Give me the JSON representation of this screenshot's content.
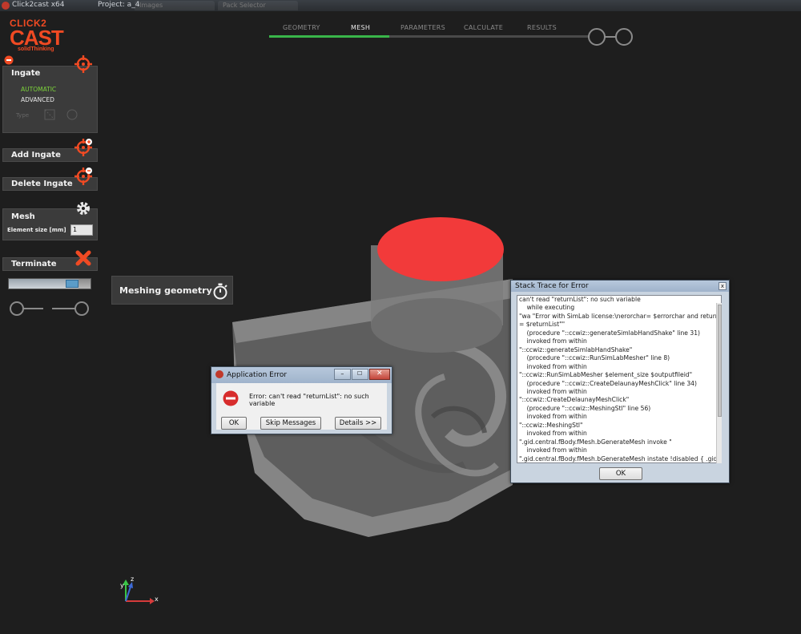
{
  "window": {
    "app_title": "Click2cast x64",
    "project": "Project: a_4",
    "ghost_tabs": [
      "Images",
      "Pack Selector"
    ]
  },
  "logo": {
    "line1": "CLICK2",
    "line2": "CAST",
    "line3": "solidThinking"
  },
  "steps": [
    {
      "label": "GEOMETRY",
      "state": "done"
    },
    {
      "label": "MESH",
      "state": "active"
    },
    {
      "label": "PARAMETERS",
      "state": "pending"
    },
    {
      "label": "CALCULATE",
      "state": "pending"
    },
    {
      "label": "RESULTS",
      "state": "pending"
    }
  ],
  "left_panel": {
    "ingate": {
      "title": "Ingate",
      "option_automatic": "AUTOMATIC",
      "option_advanced": "ADVANCED",
      "type_label": "Type"
    },
    "add_ingate": {
      "title": "Add Ingate"
    },
    "delete_ingate": {
      "title": "Delete Ingate"
    },
    "mesh": {
      "title": "Mesh",
      "element_size_label": "Element size [mm]",
      "element_size_value": "1"
    },
    "terminate": {
      "title": "Terminate"
    },
    "progress_fraction": 0.85
  },
  "tooltip": {
    "text": "Meshing geometry"
  },
  "app_error": {
    "title": "Application Error",
    "message": "Error: can't read \"returnList\": no such variable",
    "ok_label": "OK",
    "skip_label": "Skip Messages",
    "details_label": "Details >>"
  },
  "stack_trace": {
    "title": "Stack Trace for Error",
    "ok_label": "OK",
    "lines": [
      "can't read \"returnList\": no such variable",
      "    while executing",
      "\"wa \"Error with SimLab license:\\nerorchar= $errorchar and returnList",
      "= $returnList\"\"",
      "    (procedure \"::ccwiz::generateSimlabHandShake\" line 31)",
      "    invoked from within",
      "\"::ccwiz::generateSimlabHandShake\"",
      "    (procedure \"::ccwiz::RunSimLabMesher\" line 8)",
      "    invoked from within",
      "\"::ccwiz::RunSimLabMesher $element_size $outputfileid\"",
      "    (procedure \"::ccwiz::CreateDelaunayMeshClick\" line 34)",
      "    invoked from within",
      "\"::ccwiz::CreateDelaunayMeshClick\"",
      "    (procedure \"::ccwiz::MeshingStl\" line 56)",
      "    invoked from within",
      "\"::ccwiz::MeshingStl\"",
      "    invoked from within",
      "\".gid.central.fBody.fMesh.bGenerateMesh invoke \"",
      "    invoked from within",
      "\".gid.central.fBody.fMesh.bGenerateMesh instate !disabled { .gid.cen"
    ]
  },
  "axes": {
    "x": "x",
    "y": "y",
    "z": "z"
  },
  "colors": {
    "accent_orange": "#f04a23",
    "step_done_green": "#39b54a",
    "ingate_active_green": "#7cd43a",
    "part_top_red": "#f23a3a"
  }
}
